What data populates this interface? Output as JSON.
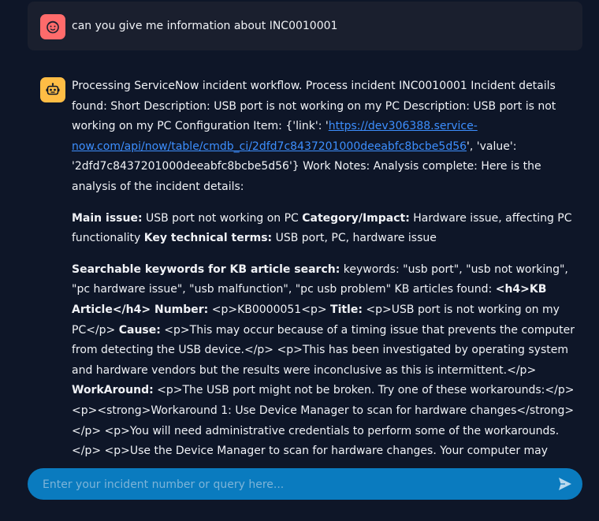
{
  "user_message": {
    "text": "can you give me information about INC0010001"
  },
  "assistant_message": {
    "p1_intro": "Processing ServiceNow incident workflow. Process incident INC0010001 Incident details found: Short Description: USB port is not working on my PC Description: USB port is not working on my PC Configuration Item: {'link': '",
    "p1_link": "https://dev306388.service-now.com/api/now/table/cmdb_ci/2dfd7c8437201000deeabfc8bcbe5d56",
    "p1_after_link": "', 'value': '2dfd7c8437201000deeabfc8bcbe5d56'} Work Notes: Analysis complete: Here is the analysis of the incident details:",
    "p2_main_label": "Main issue:",
    "p2_main_text": " USB port not working on PC ",
    "p2_cat_label": "Category/Impact:",
    "p2_cat_text": " Hardware issue, affecting PC functionality ",
    "p2_terms_label": "Key technical terms:",
    "p2_terms_text": " USB port, PC, hardware issue",
    "p3_kw_label": "Searchable keywords for KB article search:",
    "p3_kw_text": " keywords: \"usb port\", \"usb not working\", \"pc hardware issue\", \"usb malfunction\", \"pc usb problem\" KB articles found: ",
    "p3_kb_label": "<h4>KB Article</h4> Number:",
    "p3_kb_text": " <p>KB0000051<p> ",
    "p3_title_label": "Title:",
    "p3_title_text": " <p>USB port is not working on my PC</p> ",
    "p3_cause_label": "Cause:",
    "p3_cause_text": " <p>This may occur because of a timing issue that prevents the computer from detecting the USB device.</p> <p>This has been investigated by operating system and hardware vendors but the results were inconclusive as this is intermittent.</p> ",
    "p3_workaround_label": "WorkAround:",
    "p3_workaround_text": " <p>The USB port might not be broken. Try one of these workarounds:</p> <p><strong>Workaround 1: Use Device Manager to scan for hardware changes</strong></p> <p>You will need administrative credentials to perform some of the workarounds.</p> <p>Use the Device Manager to scan for hardware changes. Your computer may then recognize the USB device that is connected to the"
  },
  "chat_input": {
    "placeholder": "Enter your incident number or query here..."
  },
  "icons": {
    "user_avatar": "user-face-icon",
    "bot_avatar": "robot-icon",
    "send": "send-arrow-icon"
  },
  "colors": {
    "background": "#0e1628",
    "user_card": "#1a1f2e",
    "user_avatar": "#ff6b6b",
    "bot_avatar": "#ffbd45",
    "input": "#0a7bbf",
    "link": "#3d8fff"
  }
}
